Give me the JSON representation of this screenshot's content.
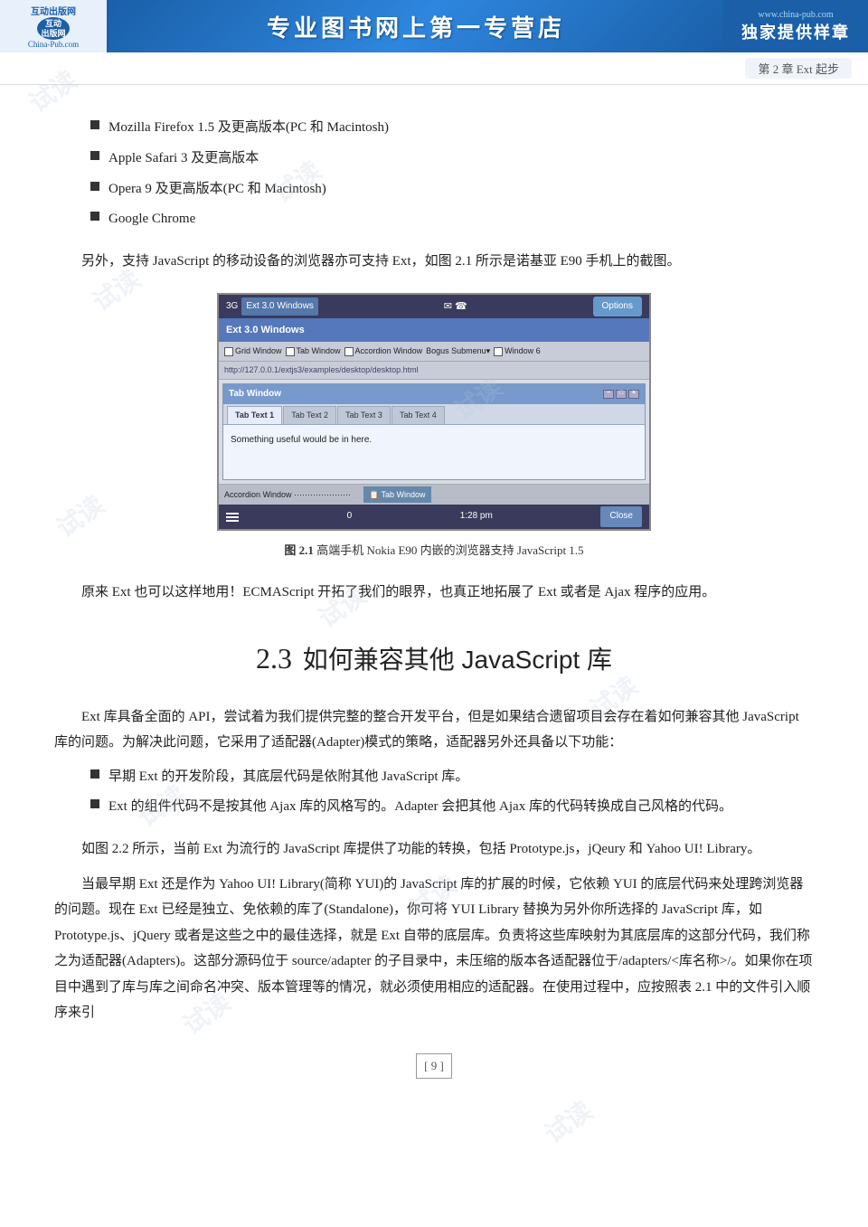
{
  "header": {
    "logo_top": "互动出版网",
    "logo_site": "China-Pub.com",
    "title": "专业图书网上第一专营店",
    "right_url": "www.china-pub.com",
    "right_slogan": "独家提供样章"
  },
  "chapter_bar": {
    "text": "第 2 章   Ext 起步"
  },
  "bullet_items": [
    "Mozilla Firefox 1.5 及更高版本(PC 和 Macintosh)",
    "Apple Safari 3 及更高版本",
    "Opera 9 及更高版本(PC 和 Macintosh)",
    "Google Chrome"
  ],
  "para1": "另外，支持 JavaScript 的移动设备的浏览器亦可支持 Ext，如图 2.1 所示是诺基亚 E90 手机上的截图。",
  "nokia_screenshot": {
    "status_bar_left": "3G  Ext 3.0 Windows",
    "status_bar_mid": "✉☎",
    "status_bar_right": "Options",
    "title_bar": "Ext 3.0 Windows",
    "nav_items": [
      "Grid Window",
      "Tab Window",
      "Accordion Window",
      "Bogus Submenu▾",
      "Window 6"
    ],
    "url": "http://127.0.0.1/extjs3/examples/desktop/desktop.html",
    "window_title": "Tab Window",
    "window_tabs": [
      "Tab Text 1",
      "Tab Text 2",
      "Tab Text 3",
      "Tab Text 4"
    ],
    "window_content": "Something useful would be in here.",
    "accordion_label": "Accordion Window",
    "tab_window2": "Tab Window",
    "status_left": "0",
    "status_time": "1:28 pm",
    "status_right": "Close"
  },
  "figure_caption": {
    "label": "图 2.1",
    "text": "   高端手机 Nokia E90 内嵌的浏览器支持 JavaScript 1.5"
  },
  "para2": "原来 Ext 也可以这样地用！ECMAScript 开拓了我们的眼界，也真正地拓展了 Ext 或者是 Ajax 程序的应用。",
  "section": {
    "number": "2.3",
    "title": "如何兼容其他 JavaScript 库"
  },
  "para3": "Ext 库具备全面的 API，尝试着为我们提供完整的整合开发平台，但是如果结合遗留项目会存在着如何兼容其他 JavaScript 库的问题。为解决此问题，它采用了适配器(Adapter)模式的策略，适配器另外还具备以下功能：",
  "bullet2_items": [
    "早期 Ext 的开发阶段，其底层代码是依附其他 JavaScript 库。",
    "Ext 的组件代码不是按其他 Ajax 库的风格写的。Adapter 会把其他 Ajax 库的代码转换成自己风格的代码。"
  ],
  "para4": "如图 2.2 所示，当前 Ext 为流行的 JavaScript 库提供了功能的转换，包括 Prototype.js，jQeury 和 Yahoo UI! Library。",
  "para5": "当最早期 Ext 还是作为 Yahoo UI! Library(简称 YUI)的 JavaScript 库的扩展的时候，它依赖 YUI 的底层代码来处理跨浏览器的问题。现在 Ext 已经是独立、免依赖的库了(Standalone)，你可将 YUI Library 替换为另外你所选择的 JavaScript 库，如 Prototype.js、jQuery 或者是这些之中的最佳选择，就是 Ext 自带的底层库。负责将这些库映射为其底层库的这部分代码，我们称之为适配器(Adapters)。这部分源码位于 source/adapter 的子目录中，未压缩的版本各适配器位于/adapters/<库名称>/。如果你在项目中遇到了库与库之间命名冲突、版本管理等的情况，就必须使用相应的适配器。在使用过程中，应按照表 2.1 中的文件引入顺序来引",
  "page_number": "[ 9 ]"
}
